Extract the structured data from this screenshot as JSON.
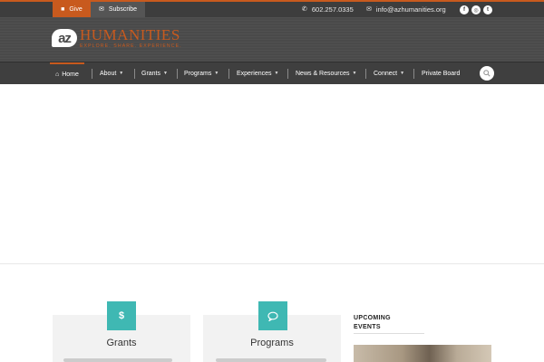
{
  "topbar": {
    "give_label": "Give",
    "subscribe_label": "Subscribe",
    "phone": "602.257.0335",
    "email": "info@azhumanities.org"
  },
  "logo": {
    "badge": "az",
    "word": "HUMANITIES",
    "tagline": "EXPLORE. SHARE. EXPERIENCE."
  },
  "nav": {
    "items": [
      {
        "label": "Home"
      },
      {
        "label": "About"
      },
      {
        "label": "Grants"
      },
      {
        "label": "Programs"
      },
      {
        "label": "Experiences"
      },
      {
        "label": "News & Resources"
      },
      {
        "label": "Connect"
      },
      {
        "label": "Private Board"
      }
    ]
  },
  "cards": [
    {
      "title": "Grants",
      "icon": "$"
    },
    {
      "title": "Programs",
      "icon": "💬"
    }
  ],
  "events": {
    "title_line1": "UPCOMING",
    "title_line2": "EVENTS"
  },
  "colors": {
    "accent": "#c85a1e",
    "teal": "#3fb8b3",
    "topbar": "#3d3d3d",
    "header": "#4a4a4a"
  }
}
